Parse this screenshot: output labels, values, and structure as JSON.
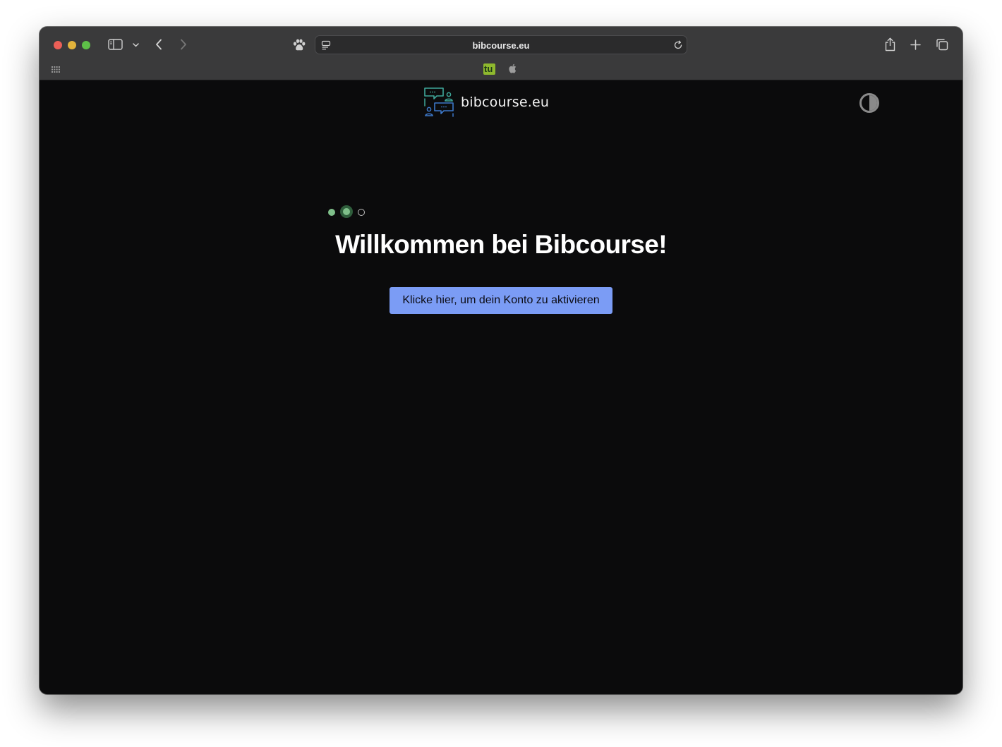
{
  "browser": {
    "url": "bibcourse.eu",
    "icons": {
      "sidebar": "sidebar-icon",
      "sidebar_menu": "chevron-down-icon",
      "back": "chevron-left-icon",
      "forward": "chevron-right-icon",
      "extension": "paw-icon",
      "page_settings": "page-menu-icon",
      "reload": "reload-icon",
      "share": "share-icon",
      "new_tab": "plus-icon",
      "tab_overview": "tabs-icon",
      "favorites_grid": "grid-icon"
    },
    "favorites": [
      {
        "name": "tu-favicon",
        "text": "tu"
      },
      {
        "name": "apple-favicon",
        "text": ""
      }
    ]
  },
  "page": {
    "brand_name": "bibcourse.eu",
    "theme_toggle_icon": "contrast-icon",
    "progress": {
      "total": 3,
      "completed": 1,
      "current": 2
    },
    "headline": "Willkommen bei Bibcourse!",
    "activate_button": "Klicke hier, um dein Konto zu aktivieren"
  },
  "colors": {
    "page_background": "#0b0b0c",
    "button": "#7b9cf5",
    "step_active": "#7fbf8a",
    "logo_teal": "#3fa79a",
    "logo_blue": "#3d78c9"
  }
}
